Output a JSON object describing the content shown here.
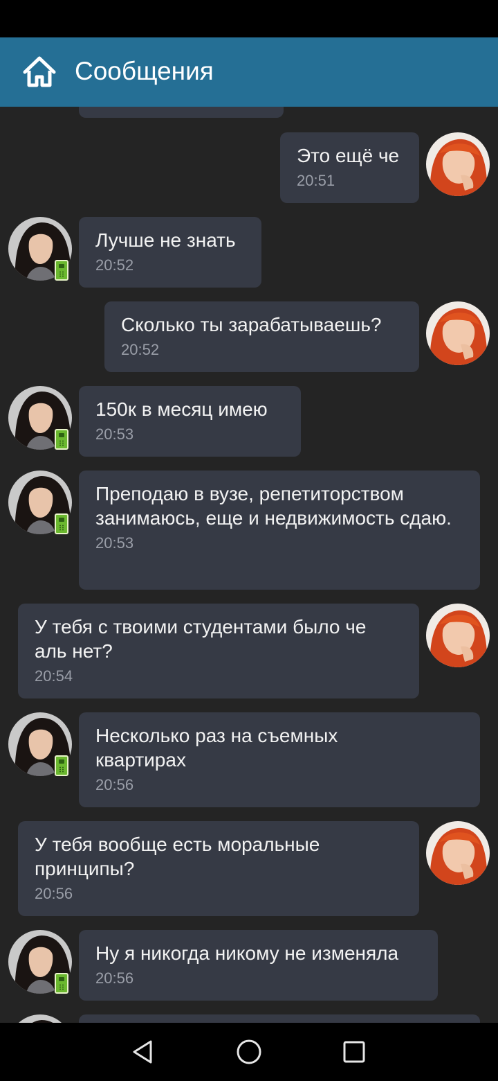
{
  "app_bar": {
    "title": "Сообщения",
    "icon": "home-icon"
  },
  "messages": [
    {
      "side": "out",
      "text": "Это ещё че",
      "time": "20:51"
    },
    {
      "side": "in",
      "text": "Лучше не знать",
      "time": "20:52"
    },
    {
      "side": "out",
      "text": "Сколько ты зарабатываешь?",
      "time": "20:52"
    },
    {
      "side": "in",
      "text": "150к в месяц имею",
      "time": "20:53"
    },
    {
      "side": "in",
      "text": "Преподаю в вузе, репетиторством занимаюсь, еще и недвижимость сдаю.",
      "time": "20:53"
    },
    {
      "side": "out",
      "text": "У тебя с твоими студентами было че аль нет?",
      "time": "20:54"
    },
    {
      "side": "in",
      "text": "Несколько раз на съемных квартирах",
      "time": "20:56"
    },
    {
      "side": "out",
      "text": "У тебя вообще есть моральные принципы?",
      "time": "20:56"
    },
    {
      "side": "in",
      "text": "Ну я никогда никому не изменяла",
      "time": "20:56"
    }
  ],
  "nav": {
    "back": "back-icon",
    "home": "home-circle-icon",
    "recents": "recents-icon"
  },
  "colors": {
    "app_bar": "#256f95",
    "background": "#242424",
    "bubble": "#363a45",
    "time": "#9a9ea8",
    "online_mobile": "#6bb82f"
  }
}
